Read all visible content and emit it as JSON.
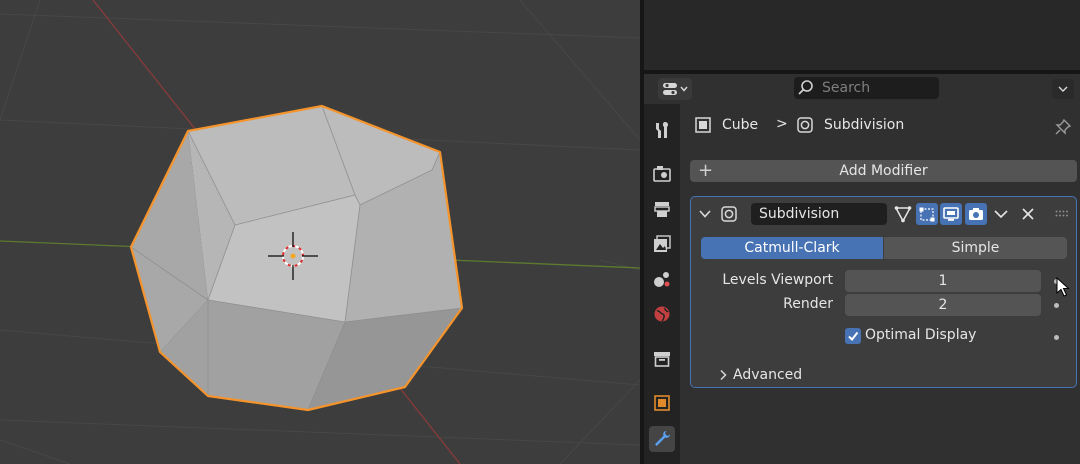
{
  "viewport": {
    "name": "3D Viewport"
  },
  "header": {
    "search_placeholder": "Search",
    "editor_type_icon": "properties-editor-icon"
  },
  "breadcrumb": {
    "object": "Cube",
    "separator": ">",
    "modifier": "Subdivision"
  },
  "tabs": [
    "tool-icon",
    "render-icon",
    "output-icon",
    "view-layer-icon",
    "scene-icon",
    "world-icon",
    "collection-icon",
    "object-icon",
    "modifier-wrench-icon"
  ],
  "modifier": {
    "add_label": "Add Modifier",
    "add_plus": "+",
    "name": "Subdivision",
    "method_options": [
      "Catmull-Clark",
      "Simple"
    ],
    "method_selected": "Catmull-Clark",
    "levels_viewport_label": "Levels Viewport",
    "levels_viewport_value": "1",
    "render_label": "Render",
    "render_value": "2",
    "optimal_display_label": "Optimal Display",
    "optimal_display_checked": true,
    "advanced_label": "Advanced"
  },
  "colors": {
    "accent": "#4772b3",
    "selection_outline": "#f5942c",
    "viewport_bg": "#3d3d3d"
  }
}
